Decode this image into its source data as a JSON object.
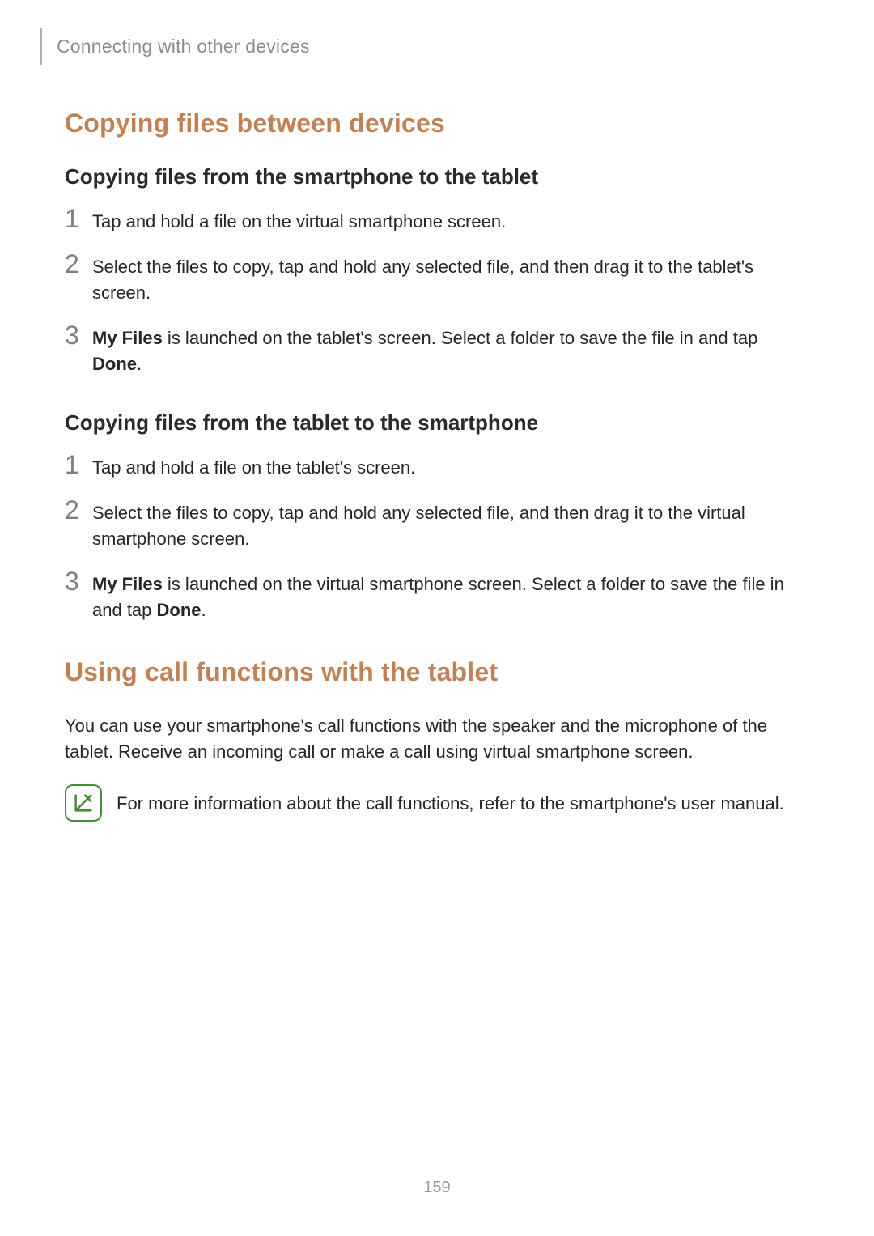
{
  "header": {
    "breadcrumb": "Connecting with other devices"
  },
  "section1": {
    "title": "Copying files between devices",
    "sub1": {
      "title": "Copying files from the smartphone to the tablet",
      "steps": {
        "n1": "1",
        "t1": "Tap and hold a file on the virtual smartphone screen.",
        "n2": "2",
        "t2": "Select the files to copy, tap and hold any selected file, and then drag it to the tablet's screen.",
        "n3": "3",
        "t3a": "My Files",
        "t3b": " is launched on the tablet's screen. Select a folder to save the file in and tap ",
        "t3c": "Done",
        "t3d": "."
      }
    },
    "sub2": {
      "title": "Copying files from the tablet to the smartphone",
      "steps": {
        "n1": "1",
        "t1": "Tap and hold a file on the tablet's screen.",
        "n2": "2",
        "t2": "Select the files to copy, tap and hold any selected file, and then drag it to the virtual smartphone screen.",
        "n3": "3",
        "t3a": "My Files",
        "t3b": " is launched on the virtual smartphone screen. Select a folder to save the file in and tap ",
        "t3c": "Done",
        "t3d": "."
      }
    }
  },
  "section2": {
    "title": "Using call functions with the tablet",
    "para": "You can use your smartphone's call functions with the speaker and the microphone of the tablet. Receive an incoming call or make a call using virtual smartphone screen.",
    "note": "For more information about the call functions, refer to the smartphone's user manual."
  },
  "page_number": "159"
}
